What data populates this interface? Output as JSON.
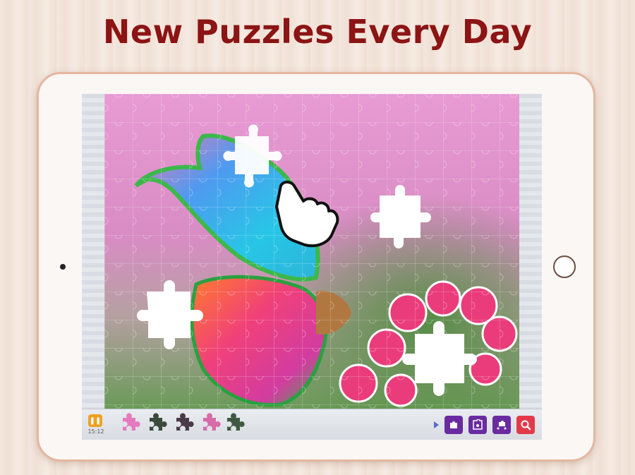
{
  "headline": "New Puzzles Every Day",
  "timer": "15:12",
  "colors": {
    "headline": "#8c1414",
    "accent_pause": "#f0a020",
    "tool_button": "#6a2ba0",
    "search_button": "#e33a4a"
  },
  "icons": {
    "pause": "pause-icon",
    "hint_1": "piece-hint-icon",
    "hint_2": "edge-pieces-icon",
    "hint_3": "scatter-pieces-icon",
    "search": "magnifier-icon",
    "tray_arrow": "arrow-right-icon",
    "hand": "hand-pointer-icon"
  }
}
